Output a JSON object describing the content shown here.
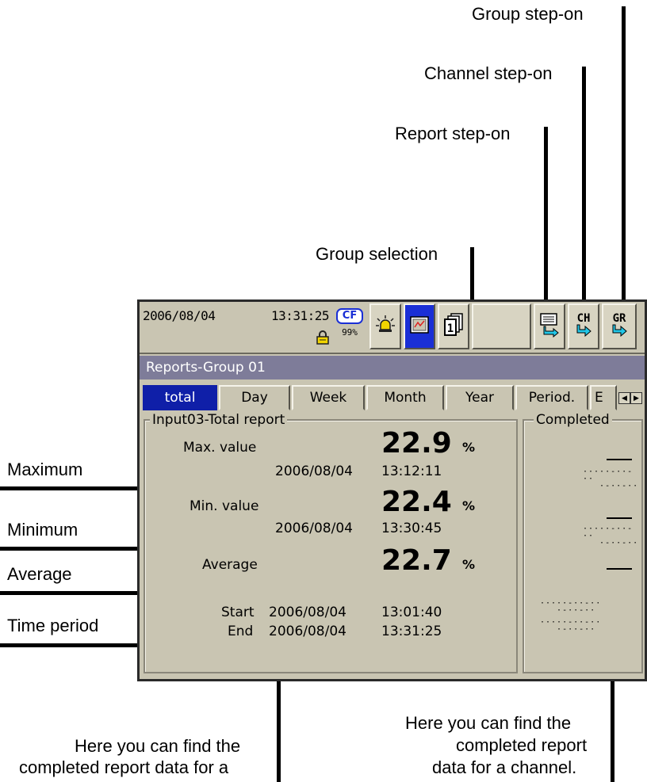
{
  "callouts": {
    "group_step_on": "Group step-on",
    "channel_step_on": "Channel step-on",
    "report_step_on": "Report step-on",
    "group_selection": "Group selection",
    "maximum": "Maximum",
    "minimum": "Minimum",
    "average": "Average",
    "time_period": "Time period",
    "group_report_note": [
      "Here you can find the",
      "completed report data for a"
    ],
    "channel_report_note": [
      "Here you can find the",
      "completed report",
      "data for a channel."
    ]
  },
  "status_bar": {
    "date": "2006/08/04",
    "time": "13:31:25",
    "memory_label": "CF",
    "memory_percent": "99%",
    "icons": [
      "lock-icon",
      "alarm-icon",
      "report-display-icon",
      "group-selection-icon",
      "report-step-on-icon",
      "channel-step-on-icon",
      "group-step-on-icon"
    ],
    "channel_button_label": "CH",
    "group_button_label": "GR",
    "group_number": "1"
  },
  "title": "Reports-Group 01",
  "tabs": [
    {
      "label": "total",
      "active": true
    },
    {
      "label": "Day",
      "active": false
    },
    {
      "label": "Week",
      "active": false
    },
    {
      "label": "Month",
      "active": false
    },
    {
      "label": "Year",
      "active": false
    },
    {
      "label": "Period.",
      "active": false
    },
    {
      "label": "E",
      "active": false
    }
  ],
  "report": {
    "title": "Input03-Total report",
    "max": {
      "label": "Max. value",
      "value": "22.9",
      "unit": "%",
      "date": "2006/08/04",
      "time": "13:12:11"
    },
    "min": {
      "label": "Min. value",
      "value": "22.4",
      "unit": "%",
      "date": "2006/08/04",
      "time": "13:30:45"
    },
    "avg": {
      "label": "Average",
      "value": "22.7",
      "unit": "%"
    },
    "start": {
      "label": "Start",
      "date": "2006/08/04",
      "time": "13:01:40"
    },
    "end": {
      "label": "End",
      "date": "2006/08/04",
      "time": "13:31:25"
    }
  },
  "completed": {
    "title": "Completed"
  },
  "colors": {
    "screen_bg": "#c9c5b2",
    "title_bar": "#7e7c99",
    "active_tab": "#0f1fa8",
    "active_button": "#1a2fd6"
  }
}
